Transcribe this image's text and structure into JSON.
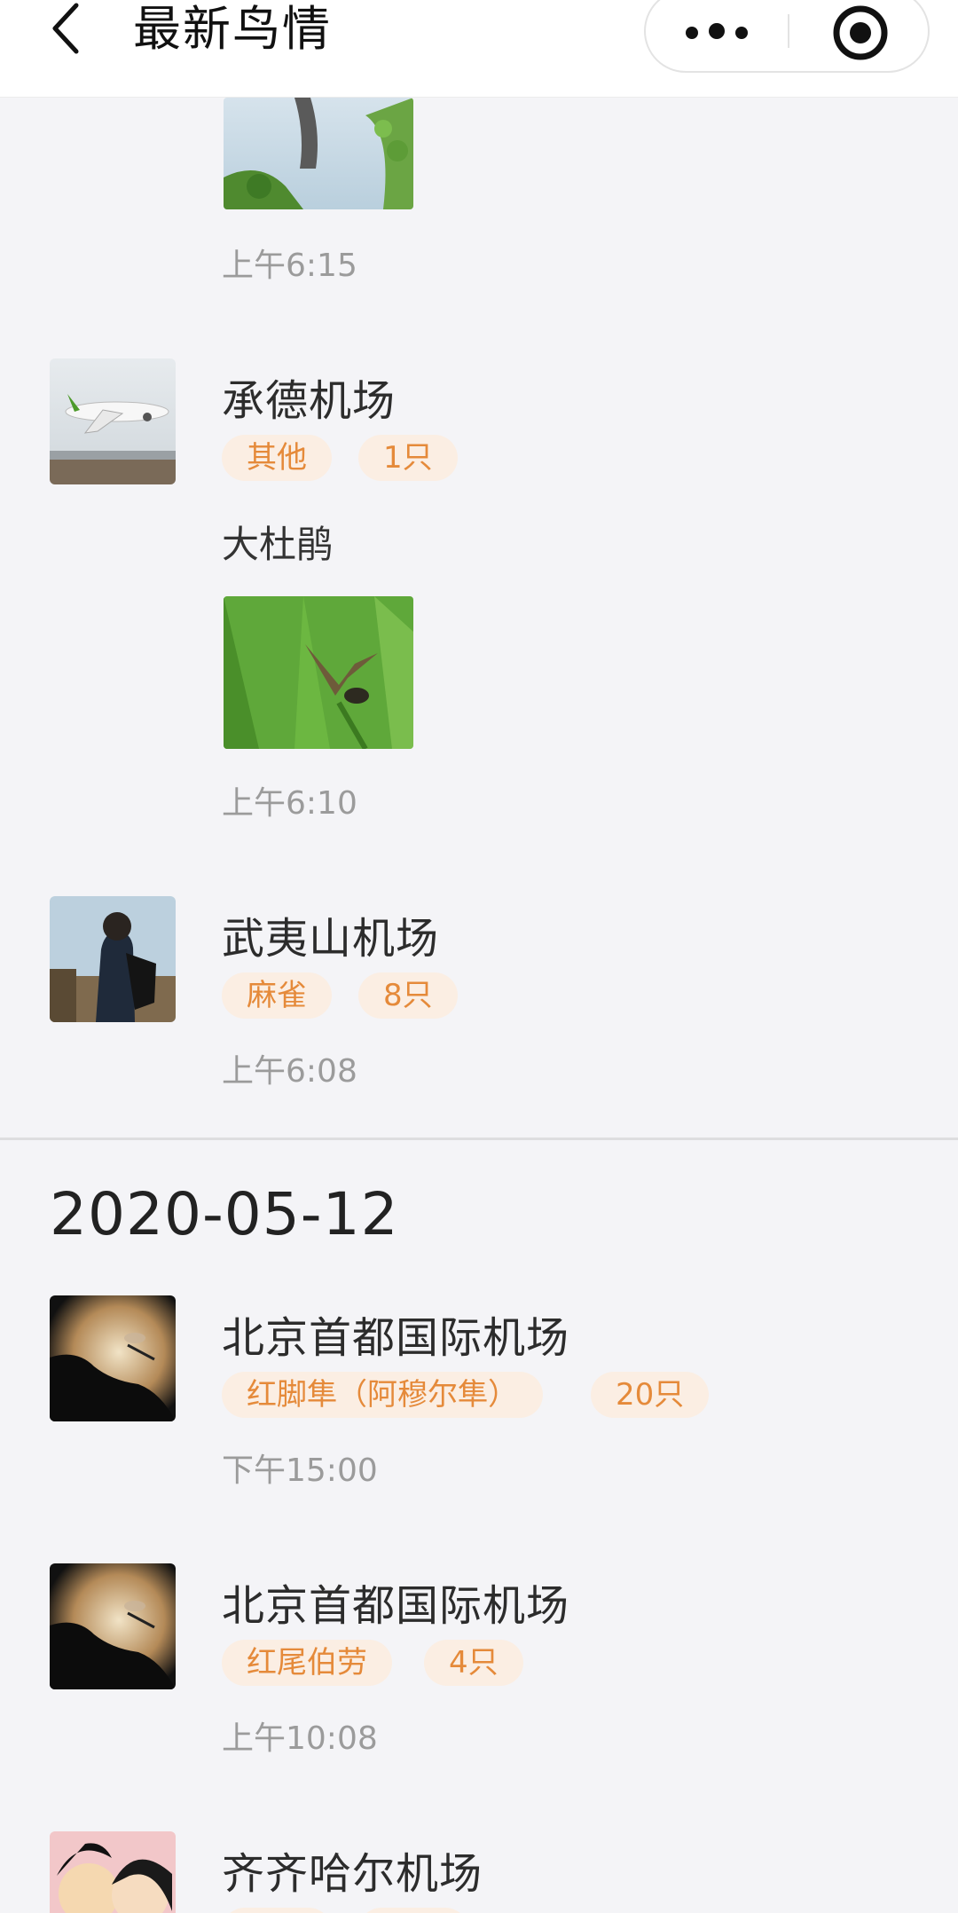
{
  "nav": {
    "title": "最新鸟情"
  },
  "sections": [
    {
      "entries": [
        {
          "time": "上午6:15"
        },
        {
          "name": "承德机场",
          "species": "其他",
          "count": "1只",
          "description": "大杜鹃",
          "time": "上午6:10"
        },
        {
          "name": "武夷山机场",
          "species": "麻雀",
          "count": "8只",
          "time": "上午6:08"
        }
      ]
    },
    {
      "date": "2020-05-12",
      "entries": [
        {
          "name": "北京首都国际机场",
          "species": "红脚隼（阿穆尔隼）",
          "count": "20只",
          "time": "下午15:00"
        },
        {
          "name": "北京首都国际机场",
          "species": "红尾伯劳",
          "count": "4只",
          "time": "上午10:08"
        },
        {
          "name": "齐齐哈尔机场"
        }
      ]
    }
  ],
  "colors": {
    "tag_bg": "#fbeee3",
    "tag_text": "#e58a3a",
    "time_text": "#9b9b9b",
    "background": "#f4f4f7"
  }
}
